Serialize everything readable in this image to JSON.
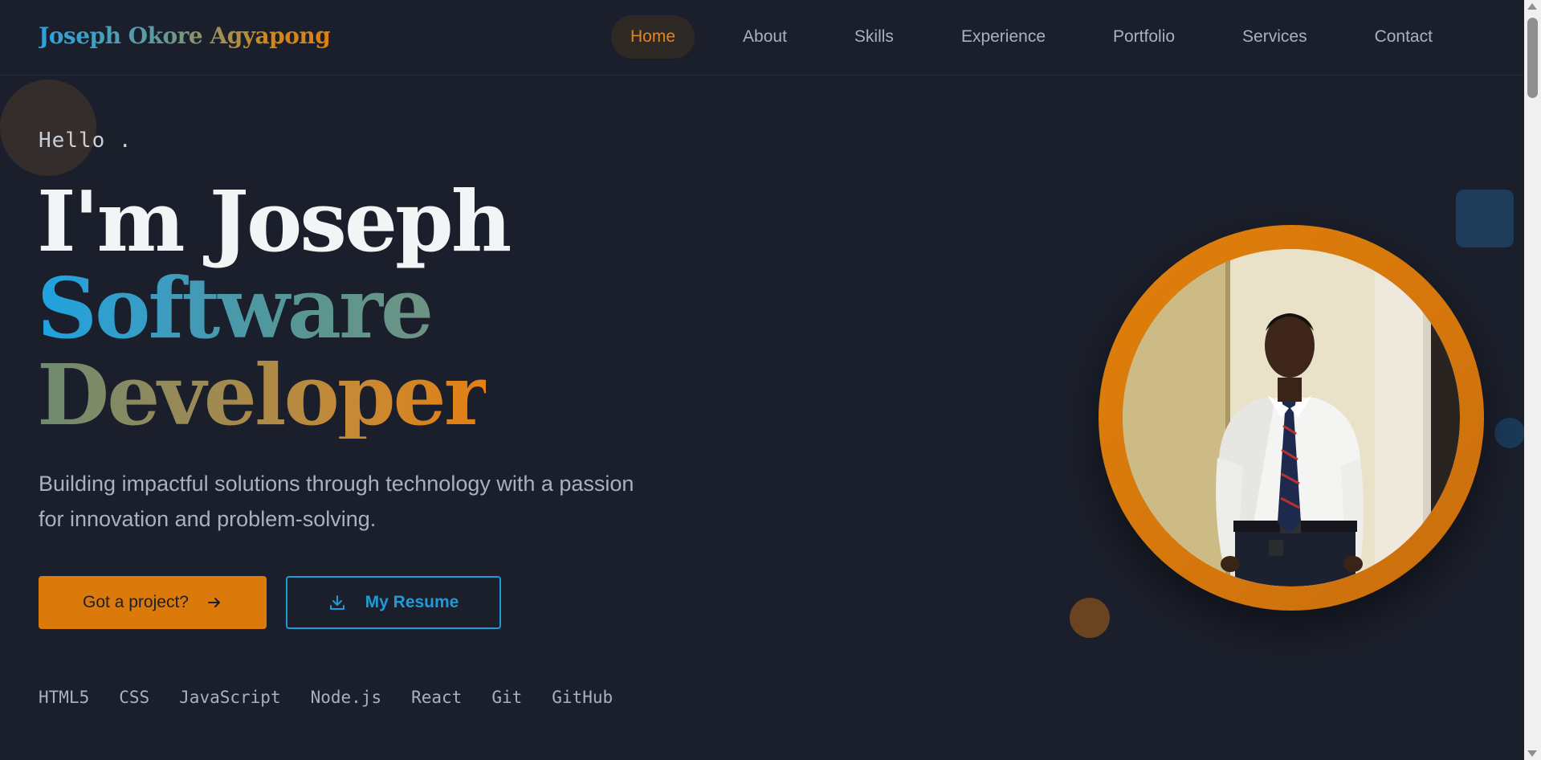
{
  "brand": {
    "name": "Joseph Okore Agyapong"
  },
  "nav": {
    "items": [
      {
        "label": "Home",
        "active": true
      },
      {
        "label": "About"
      },
      {
        "label": "Skills"
      },
      {
        "label": "Experience"
      },
      {
        "label": "Portfolio"
      },
      {
        "label": "Services"
      },
      {
        "label": "Contact"
      }
    ]
  },
  "hero": {
    "greeting": "Hello .",
    "headline_line1": "I'm Joseph",
    "headline_line2": "Software",
    "headline_line3": "Developer",
    "tagline": "Building impactful solutions through technology with a passion for innovation and problem-solving.",
    "primary_button": "Got a project?",
    "secondary_button": "My Resume",
    "tech_stack": [
      "HTML5",
      "CSS",
      "JavaScript",
      "Node.js",
      "React",
      "Git",
      "GitHub"
    ]
  },
  "colors": {
    "background": "#1b1f2b",
    "accent_orange": "#db7a0b",
    "accent_blue": "#1e9bd7",
    "text_muted": "#a7b1c2"
  },
  "icons": {
    "primary_button_icon": "arrow-right-icon",
    "secondary_button_icon": "download-icon"
  }
}
